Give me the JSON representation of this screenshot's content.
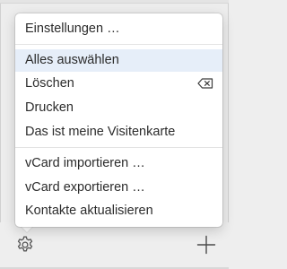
{
  "menu": {
    "items": [
      {
        "label": "Einstellungen …"
      },
      {
        "label": "Alles auswählen",
        "highlighted": true
      },
      {
        "label": "Löschen",
        "shortcut_icon": "delete-key-icon"
      },
      {
        "label": "Drucken"
      },
      {
        "label": "Das ist meine Visitenkarte"
      },
      {
        "label": "vCard importieren …"
      },
      {
        "label": "vCard exportieren …"
      },
      {
        "label": "Kontakte aktualisieren"
      }
    ]
  },
  "footer": {
    "left_icon": "gear-icon",
    "right_icon": "plus-icon"
  },
  "colors": {
    "highlight": "#e6eef9",
    "text": "#2b2b2b",
    "menu_background": "#ffffff",
    "window_background": "#ededed"
  }
}
